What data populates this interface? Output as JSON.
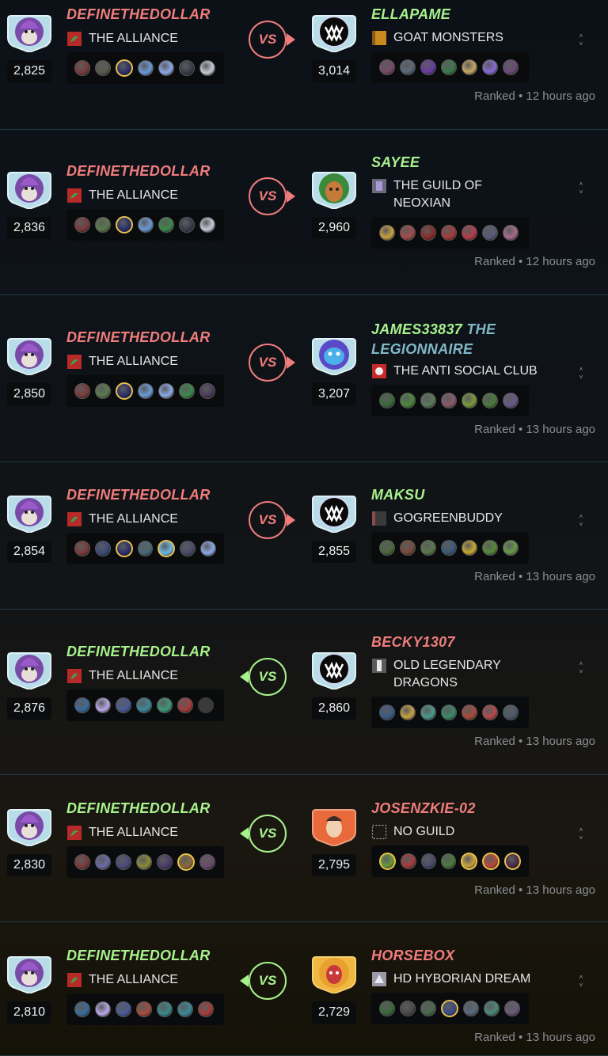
{
  "battles": [
    {
      "player": {
        "name": "DEFINETHEDOLLAR",
        "result": "loss",
        "rating": "2,825",
        "guild": "THE ALLIANCE"
      },
      "opponent": {
        "name": "ELLAPAME",
        "title": "",
        "result": "win",
        "rating": "3,014",
        "guild": "GOAT MONSTERS",
        "avatar": "monster-avatar"
      },
      "meta": "Ranked • 12 hours ago",
      "direction": "right",
      "player_units": [
        "#7a3a3a",
        "#5a5a4a",
        "#2a2e6a",
        "#6a9ad8",
        "#8aa8e8",
        "#3a3a4a",
        "#c8c8d8"
      ],
      "player_gold": [
        2
      ],
      "opponent_units": [
        "#7a4a6a",
        "#5a6a7a",
        "#6a3aa8",
        "#3a7a4a",
        "#c8a860",
        "#8a6ad8",
        "#6a4a7a"
      ],
      "opponent_gold": []
    },
    {
      "player": {
        "name": "DEFINETHEDOLLAR",
        "result": "loss",
        "rating": "2,836",
        "guild": "THE ALLIANCE"
      },
      "opponent": {
        "name": "SAYEE",
        "title": "",
        "result": "win",
        "rating": "2,960",
        "guild": "THE GUILD OF NEOXIAN",
        "avatar": "tree-avatar"
      },
      "meta": "Ranked • 12 hours ago",
      "direction": "right",
      "player_units": [
        "#7a3a3a",
        "#5a7a4a",
        "#2a2e6a",
        "#6a9ad8",
        "#3a8a4a",
        "#3a3a4a",
        "#c8c8d8"
      ],
      "player_gold": [
        2
      ],
      "opponent_units": [
        "#c8a040",
        "#a84a4a",
        "#8a2a2a",
        "#a83a3a",
        "#b83a4a",
        "#5a5a7a",
        "#a86a8a"
      ],
      "opponent_gold": []
    },
    {
      "player": {
        "name": "DEFINETHEDOLLAR",
        "result": "loss",
        "rating": "2,850",
        "guild": "THE ALLIANCE"
      },
      "opponent": {
        "name": "JAMES33837",
        "title": "THE LEGIONNAIRE",
        "result": "win",
        "rating": "3,207",
        "guild": "THE ANTI SOCIAL CLUB",
        "avatar": "dragon-avatar"
      },
      "meta": "Ranked • 13 hours ago",
      "direction": "right",
      "player_units": [
        "#7a3a3a",
        "#5a7a4a",
        "#2a2e6a",
        "#6a9ad8",
        "#8aa8e8",
        "#3a8a4a",
        "#4a3a5a"
      ],
      "player_gold": [
        2
      ],
      "opponent_units": [
        "#3a6a3a",
        "#4a8a3a",
        "#5a7a5a",
        "#8a5a6a",
        "#7a9a3a",
        "#4a7a3a",
        "#6a5a8a"
      ],
      "opponent_gold": []
    },
    {
      "player": {
        "name": "DEFINETHEDOLLAR",
        "result": "loss",
        "rating": "2,854",
        "guild": "THE ALLIANCE"
      },
      "opponent": {
        "name": "MAKSU",
        "title": "",
        "result": "win",
        "rating": "2,855",
        "guild": "GOGREENBUDDY",
        "avatar": "monster-avatar"
      },
      "meta": "Ranked • 13 hours ago",
      "direction": "right",
      "player_units": [
        "#7a3a3a",
        "#3a4a7a",
        "#2a2e6a",
        "#4a6a7a",
        "#6ab8e8",
        "#4a4a6a",
        "#8aa8e8"
      ],
      "player_gold": [
        2,
        4
      ],
      "opponent_units": [
        "#4a6a3a",
        "#7a4a3a",
        "#5a7a4a",
        "#3a5a7a",
        "#c8a830",
        "#5a8a3a",
        "#6a9a4a"
      ],
      "opponent_gold": []
    },
    {
      "player": {
        "name": "DEFINETHEDOLLAR",
        "result": "win",
        "rating": "2,876",
        "guild": "THE ALLIANCE"
      },
      "opponent": {
        "name": "BECKY1307",
        "title": "",
        "result": "loss",
        "rating": "2,860",
        "guild": "OLD LEGENDARY DRAGONS",
        "avatar": "monster-avatar"
      },
      "meta": "Ranked • 13 hours ago",
      "direction": "left",
      "player_units": [
        "#3a6a9a",
        "#b8a8e8",
        "#4a5a9a",
        "#3a8a9a",
        "#3a9a7a",
        "#a83a3a",
        "empty"
      ],
      "player_gold": [],
      "opponent_units": [
        "#3a5a8a",
        "#c8a040",
        "#4a9a8a",
        "#3a8a6a",
        "#a84a3a",
        "#b84a4a",
        "#4a5a6a"
      ],
      "opponent_gold": []
    },
    {
      "player": {
        "name": "DEFINETHEDOLLAR",
        "result": "win",
        "rating": "2,830",
        "guild": "THE ALLIANCE"
      },
      "opponent": {
        "name": "JOSENZKIE-02",
        "title": "",
        "result": "loss",
        "rating": "2,795",
        "guild": "NO GUILD",
        "avatar": "hero-avatar"
      },
      "meta": "Ranked • 13 hours ago",
      "direction": "left",
      "player_units": [
        "#7a3a3a",
        "#6a6aa8",
        "#4a4a7a",
        "#8a8a3a",
        "#4a3a6a",
        "#8a6a3a",
        "#6a4a6a"
      ],
      "player_gold": [
        5
      ],
      "opponent_units": [
        "#6a9a3a",
        "#a83a3a",
        "#4a4a6a",
        "#4a7a3a",
        "#c8a040",
        "#b84a3a",
        "#4a2a4a"
      ],
      "opponent_gold": [
        0,
        4,
        5,
        6
      ]
    },
    {
      "player": {
        "name": "DEFINETHEDOLLAR",
        "result": "win",
        "rating": "2,810",
        "guild": "THE ALLIANCE"
      },
      "opponent": {
        "name": "HORSEBOX",
        "title": "",
        "result": "loss",
        "rating": "2,729",
        "guild": "HD HYBORIAN DREAM",
        "avatar": "fire-avatar"
      },
      "meta": "Ranked • 13 hours ago",
      "direction": "left",
      "player_units": [
        "#3a6a9a",
        "#b8a8e8",
        "#4a5a9a",
        "#a84a3a",
        "#3a8a8a",
        "#3a8a9a",
        "#a83a3a"
      ],
      "player_gold": [],
      "opponent_units": [
        "#3a6a3a",
        "#4a4a4a",
        "#4a6a4a",
        "#3a4a8a",
        "#5a6a7a",
        "#4a8a7a",
        "#6a5a7a"
      ],
      "opponent_gold": [
        3
      ]
    }
  ],
  "colors": {
    "win": "#a8f28c",
    "loss": "#f07c7c",
    "gold": "#e8c14a"
  },
  "vs_label": "VS"
}
